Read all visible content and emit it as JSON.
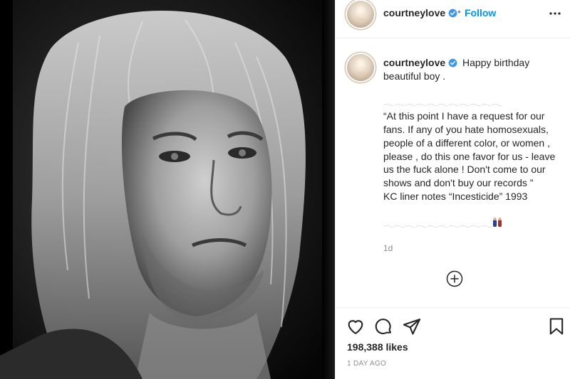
{
  "post": {
    "author": "courtneylove",
    "verified": true,
    "follow_separator": "•",
    "follow_label": "Follow",
    "caption": {
      "text_line1": "Happy birthday",
      "text_line2": "beautiful boy .",
      "emoji_row_1": "𓂃𓂃𓂃𓂃𓂃𓂃𓂃𓂃𓂃𓂃𓂃",
      "quote": "“At this point I have a request for our fans. If any of you hate homosexuals, people of a different color, or women , please , do this one favor for us - leave us the fuck alone ! Don't come to our shows and don't buy our records ”",
      "attribution": "KC liner notes “Incesticide” 1993",
      "emoji_row_2": "𓂃𓂃𓂃𓂃𓂃𓂃𓂃𓂃𓂃𓂃"
    },
    "caption_time": "1d",
    "likes": "198,388 likes",
    "posted_ago": "1 DAY AGO"
  },
  "icons": {
    "more": "more-options-icon",
    "add": "add-circle-icon",
    "like": "heart-icon",
    "comment": "comment-icon",
    "share": "share-icon",
    "save": "bookmark-icon"
  },
  "colors": {
    "link_blue": "#0095f6",
    "verified_blue": "#3897f0",
    "text": "#262626",
    "muted": "#8e8e8e"
  }
}
